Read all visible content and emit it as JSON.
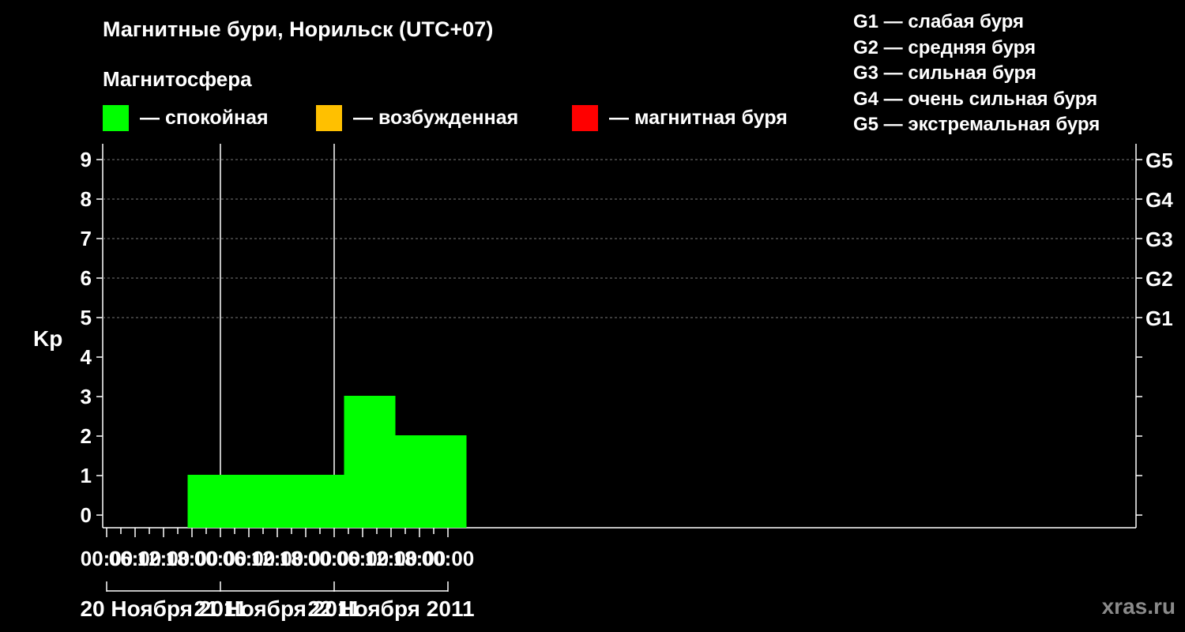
{
  "chart_data": {
    "type": "bar",
    "title": "Магнитные бури, Норильск (UTC+07)",
    "magnetosphere_label": "Магнитосфера",
    "legend": [
      {
        "label": "— спокойная",
        "color": "#00ff00"
      },
      {
        "label": "— возбужденная",
        "color": "#ffc000"
      },
      {
        "label": "— магнитная буря",
        "color": "#ff0000"
      }
    ],
    "storm_levels": [
      "G1 — слабая буря",
      "G2 — средняя буря",
      "G3 — сильная буря",
      "G4 — очень сильная буря",
      "G5 — экстремальная буря"
    ],
    "ylabel": "Kp",
    "ylim": [
      0,
      9
    ],
    "y_ticks": [
      "0",
      "1",
      "2",
      "3",
      "4",
      "5",
      "6",
      "7",
      "8",
      "9"
    ],
    "right_ticks": [
      {
        "kp": 5,
        "label": "G1"
      },
      {
        "kp": 6,
        "label": "G2"
      },
      {
        "kp": 7,
        "label": "G3"
      },
      {
        "kp": 8,
        "label": "G4"
      },
      {
        "kp": 9,
        "label": "G5"
      }
    ],
    "x_tick_labels": [
      "00:00",
      "06:00",
      "12:00",
      "18:00",
      "00:00",
      "06:00",
      "12:00",
      "18:00",
      "00:00",
      "06:00",
      "12:00",
      "18:00",
      "00:00"
    ],
    "days": [
      "20 Ноября 2011",
      "21 Ноября 2011",
      "22 Ноября 2011"
    ],
    "interval_hours": 3,
    "values": [
      null,
      null,
      null,
      null,
      null,
      null,
      null,
      1,
      1,
      1,
      1,
      null,
      1,
      1,
      1,
      null,
      1,
      1,
      3,
      3,
      2,
      2,
      2,
      2,
      2
    ],
    "bar_color": "#00ff00",
    "grid": "dashed at Kp 5–9"
  },
  "watermark": "xras.ru"
}
